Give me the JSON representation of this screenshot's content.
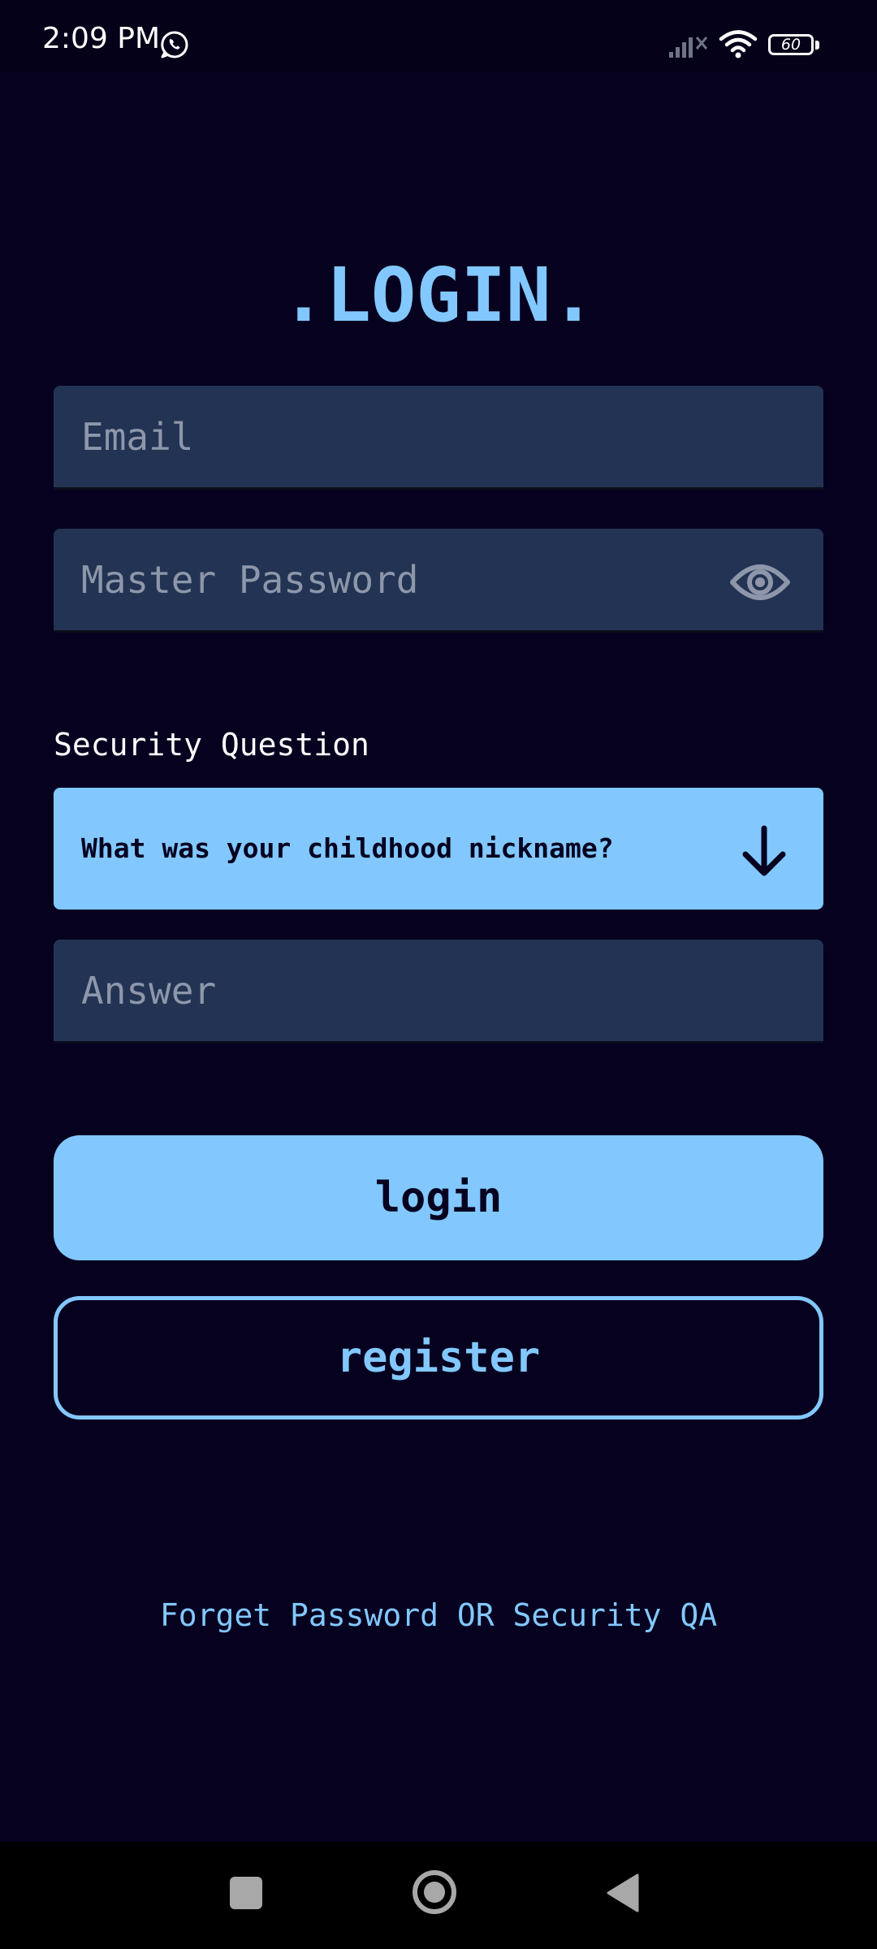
{
  "status_bar": {
    "time": "2:09 PM",
    "battery": "60"
  },
  "title": ".LOGIN.",
  "email": {
    "placeholder": "Email",
    "value": ""
  },
  "password": {
    "placeholder": "Master Password",
    "value": ""
  },
  "security": {
    "label": "Security Question",
    "selected_question": "What was your childhood nickname?"
  },
  "answer": {
    "placeholder": "Answer",
    "value": ""
  },
  "buttons": {
    "login": "login",
    "register": "register"
  },
  "forget_link": "Forget Password OR Security QA",
  "colors": {
    "background": "#05011f",
    "accent": "#82c8ff",
    "field": "#233353",
    "placeholder": "#8e97aa"
  },
  "icons": {
    "whatsapp": "whatsapp-icon",
    "signal": "cell-signal-icon",
    "wifi": "wifi-icon",
    "battery": "battery-icon",
    "eye": "eye-icon",
    "dropdown": "arrow-down-icon",
    "nav_recents": "recents-square-icon",
    "nav_home": "home-circle-icon",
    "nav_back": "back-triangle-icon"
  }
}
